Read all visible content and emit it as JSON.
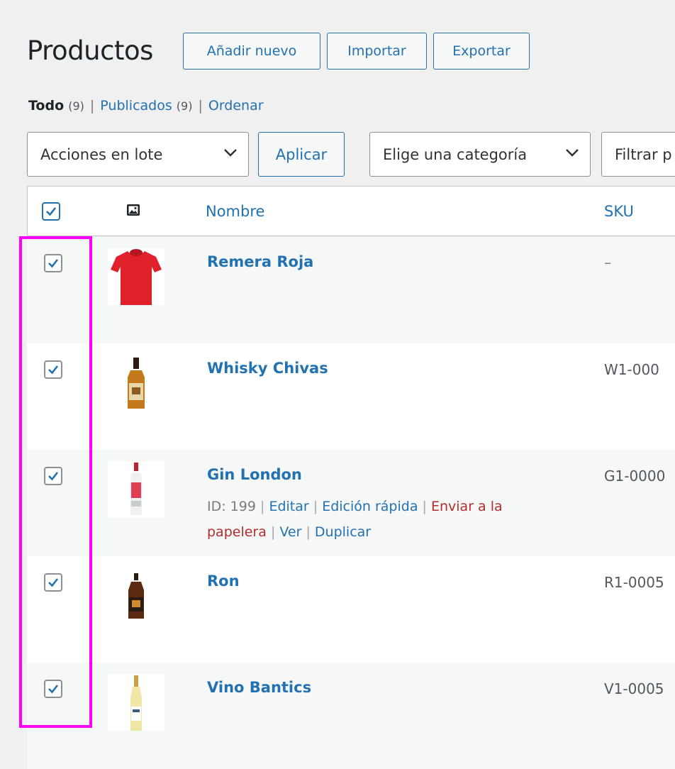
{
  "header": {
    "title": "Productos",
    "add_new": "Añadir nuevo",
    "import": "Importar",
    "export": "Exportar"
  },
  "views": {
    "all_label": "Todo",
    "all_count": "(9)",
    "published_label": "Publicados",
    "published_count": "(9)",
    "sort_label": "Ordenar"
  },
  "filters": {
    "bulk_actions": "Acciones en lote",
    "apply": "Aplicar",
    "category": "Elige una categoría",
    "filter_by": "Filtrar p"
  },
  "columns": {
    "name": "Nombre",
    "sku": "SKU"
  },
  "products": [
    {
      "name": "Remera Roja",
      "sku": "–",
      "checked": true
    },
    {
      "name": "Whisky Chivas",
      "sku": "W1-000",
      "checked": true
    },
    {
      "name": "Gin London",
      "sku": "G1-0000",
      "checked": true
    },
    {
      "name": "Ron",
      "sku": "R1-0005",
      "checked": true
    },
    {
      "name": "Vino Bantics",
      "sku": "V1-0005",
      "checked": true
    }
  ],
  "row_actions": {
    "id": "ID: 199",
    "edit": "Editar",
    "quick_edit": "Edición rápida",
    "trash_1": "Enviar a la",
    "trash_2": "papelera",
    "view": "Ver",
    "duplicate": "Duplicar"
  },
  "colors": {
    "accent": "#2271b1",
    "trash": "#b32d2e",
    "highlight": "#ff00ff"
  }
}
